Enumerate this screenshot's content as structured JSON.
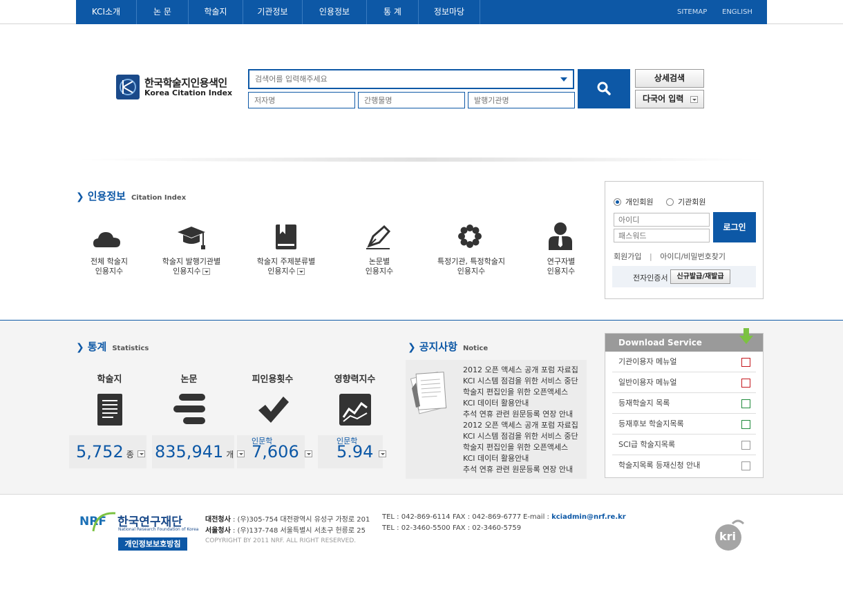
{
  "gnb": {
    "items": [
      "KCI소개",
      "논 문",
      "학술지",
      "기관정보",
      "인용정보",
      "통 계",
      "정보마당"
    ],
    "sitemap": "SITEMAP",
    "english": "ENGLISH"
  },
  "logo": {
    "ko": "한국학술지인용색인",
    "en": "Korea Citation Index"
  },
  "search": {
    "main_placeholder": "검색어를 입력해주세요",
    "author_placeholder": "저자명",
    "journal_placeholder": "간행물명",
    "publisher_placeholder": "발행기관명",
    "advanced": "상세검색",
    "multilang": "다국어 입력"
  },
  "citation": {
    "title_ko": "인용정보",
    "title_en": "Citation Index",
    "items": [
      {
        "icon": "cloud-icon",
        "line1": "전체 학술지",
        "line2": "인용지수",
        "dropdown": false
      },
      {
        "icon": "graduation-cap-icon",
        "line1": "학술지 발행기관별",
        "line2": "인용지수",
        "dropdown": true
      },
      {
        "icon": "book-icon",
        "line1": "학술지 주제분류별",
        "line2": "인용지수",
        "dropdown": true
      },
      {
        "icon": "pen-icon",
        "line1": "논문별",
        "line2": "인용지수",
        "dropdown": false
      },
      {
        "icon": "flower-icon",
        "line1": "특정기관, 특정학술지",
        "line2": "인용지수",
        "dropdown": false
      },
      {
        "icon": "person-icon",
        "line1": "연구자별",
        "line2": "인용지수",
        "dropdown": false
      }
    ]
  },
  "login": {
    "personal": "개인회원",
    "institution": "기관회원",
    "id_placeholder": "아이디",
    "pw_placeholder": "패스워드",
    "button": "로그인",
    "join": "회원가입",
    "find": "아이디/비밀번호찾기",
    "cert_label": "전자인증서",
    "cert_button": "신규발급/재발급"
  },
  "stats": {
    "title_ko": "통계",
    "title_en": "Statistics",
    "items": [
      {
        "label": "학술지",
        "icon": "document-list-icon",
        "value": "5,752",
        "unit": "종",
        "sub": ""
      },
      {
        "label": "논문",
        "icon": "bars-icon",
        "value": "835,941",
        "unit": "개",
        "sub": ""
      },
      {
        "label": "피인용횟수",
        "icon": "checkmark-icon",
        "value": "7,606",
        "unit": "",
        "sub": "인문학"
      },
      {
        "label": "영향력지수",
        "icon": "trend-chart-icon",
        "value": "5.94",
        "unit": "",
        "sub": "인문학"
      }
    ]
  },
  "notice": {
    "title_ko": "공지사항",
    "title_en": "Notice",
    "items": [
      "2012 오픈 액세스 공개 포럼 자료집",
      "KCI 시스템 점검을 위한 서비스 중단",
      "학술지 편집인을 위한 오픈액세스",
      "KCI 데이터 활용안내",
      "추석 연휴 관련 원문등록 연장 안내",
      "2012 오픈 액세스 공개 포럼 자료집",
      "KCI 시스템 점검을 위한 서비스 중단",
      "학술지 편집인을 위한 오픈액세스",
      "KCI 데이터 활용안내",
      "추석 연휴 관련 원문등록 연장 안내"
    ]
  },
  "download": {
    "title": "Download Service",
    "items": [
      {
        "label": "기관이용자 메뉴얼",
        "icon": "pdf-icon",
        "color": "#c4161c"
      },
      {
        "label": "일반이용자 메뉴얼",
        "icon": "pdf-icon",
        "color": "#c4161c"
      },
      {
        "label": "등재학술지 목록",
        "icon": "excel-icon",
        "color": "#1e8a3a"
      },
      {
        "label": "등재후보 학술지목록",
        "icon": "excel-icon",
        "color": "#1e8a3a"
      },
      {
        "label": "SCI급 학술지목록",
        "icon": "doc-icon",
        "color": "#888888"
      },
      {
        "label": "학술지목록 등재신청 안내",
        "icon": "doc-icon",
        "color": "#888888"
      }
    ]
  },
  "footer": {
    "org_ko": "한국연구재단",
    "org_en": "National Research Foundation of Korea",
    "org_short": "NRF",
    "privacy": "개인정보보호방침",
    "daejeon_label": "대전청사",
    "daejeon_addr": ": (우)305-754 대전광역시 유성구 가정로 201",
    "daejeon_tel": "TEL : 042-869-6114",
    "daejeon_fax": "FAX : 042-869-6777",
    "email_label": "E-mail :",
    "email": "kciadmin@nrf.re.kr",
    "seoul_label": "서울청사",
    "seoul_addr": ": (우)137-748 서울특별시 서초구 헌릉로 25",
    "seoul_tel": "TEL : 02-3460-5500",
    "seoul_fax": "FAX : 02-3460-5759",
    "copyright": "COPYRIGHT BY 2011 NRF. ALL RIGHT RESERVED.",
    "kri": "kri"
  },
  "colors": {
    "brand": "#0d58a6",
    "band": "#f4f4f4"
  }
}
